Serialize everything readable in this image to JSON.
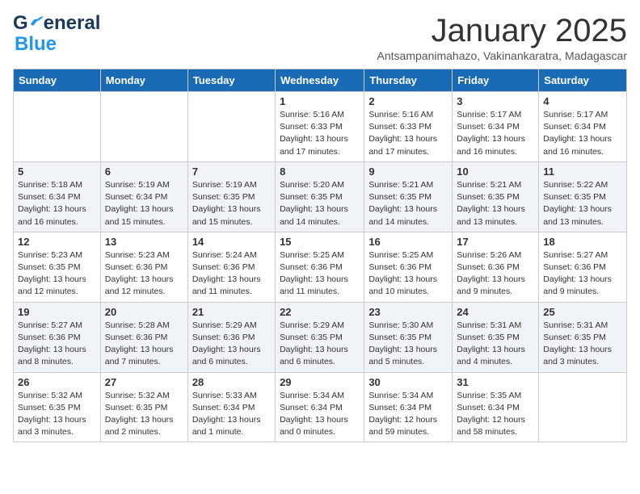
{
  "header": {
    "logo_line1": "General",
    "logo_line2": "Blue",
    "month_title": "January 2025",
    "subtitle": "Antsampanimahazo, Vakinankaratra, Madagascar"
  },
  "weekdays": [
    "Sunday",
    "Monday",
    "Tuesday",
    "Wednesday",
    "Thursday",
    "Friday",
    "Saturday"
  ],
  "weeks": [
    [
      {
        "num": "",
        "info": ""
      },
      {
        "num": "",
        "info": ""
      },
      {
        "num": "",
        "info": ""
      },
      {
        "num": "1",
        "info": "Sunrise: 5:16 AM\nSunset: 6:33 PM\nDaylight: 13 hours\nand 17 minutes."
      },
      {
        "num": "2",
        "info": "Sunrise: 5:16 AM\nSunset: 6:33 PM\nDaylight: 13 hours\nand 17 minutes."
      },
      {
        "num": "3",
        "info": "Sunrise: 5:17 AM\nSunset: 6:34 PM\nDaylight: 13 hours\nand 16 minutes."
      },
      {
        "num": "4",
        "info": "Sunrise: 5:17 AM\nSunset: 6:34 PM\nDaylight: 13 hours\nand 16 minutes."
      }
    ],
    [
      {
        "num": "5",
        "info": "Sunrise: 5:18 AM\nSunset: 6:34 PM\nDaylight: 13 hours\nand 16 minutes."
      },
      {
        "num": "6",
        "info": "Sunrise: 5:19 AM\nSunset: 6:34 PM\nDaylight: 13 hours\nand 15 minutes."
      },
      {
        "num": "7",
        "info": "Sunrise: 5:19 AM\nSunset: 6:35 PM\nDaylight: 13 hours\nand 15 minutes."
      },
      {
        "num": "8",
        "info": "Sunrise: 5:20 AM\nSunset: 6:35 PM\nDaylight: 13 hours\nand 14 minutes."
      },
      {
        "num": "9",
        "info": "Sunrise: 5:21 AM\nSunset: 6:35 PM\nDaylight: 13 hours\nand 14 minutes."
      },
      {
        "num": "10",
        "info": "Sunrise: 5:21 AM\nSunset: 6:35 PM\nDaylight: 13 hours\nand 13 minutes."
      },
      {
        "num": "11",
        "info": "Sunrise: 5:22 AM\nSunset: 6:35 PM\nDaylight: 13 hours\nand 13 minutes."
      }
    ],
    [
      {
        "num": "12",
        "info": "Sunrise: 5:23 AM\nSunset: 6:35 PM\nDaylight: 13 hours\nand 12 minutes."
      },
      {
        "num": "13",
        "info": "Sunrise: 5:23 AM\nSunset: 6:36 PM\nDaylight: 13 hours\nand 12 minutes."
      },
      {
        "num": "14",
        "info": "Sunrise: 5:24 AM\nSunset: 6:36 PM\nDaylight: 13 hours\nand 11 minutes."
      },
      {
        "num": "15",
        "info": "Sunrise: 5:25 AM\nSunset: 6:36 PM\nDaylight: 13 hours\nand 11 minutes."
      },
      {
        "num": "16",
        "info": "Sunrise: 5:25 AM\nSunset: 6:36 PM\nDaylight: 13 hours\nand 10 minutes."
      },
      {
        "num": "17",
        "info": "Sunrise: 5:26 AM\nSunset: 6:36 PM\nDaylight: 13 hours\nand 9 minutes."
      },
      {
        "num": "18",
        "info": "Sunrise: 5:27 AM\nSunset: 6:36 PM\nDaylight: 13 hours\nand 9 minutes."
      }
    ],
    [
      {
        "num": "19",
        "info": "Sunrise: 5:27 AM\nSunset: 6:36 PM\nDaylight: 13 hours\nand 8 minutes."
      },
      {
        "num": "20",
        "info": "Sunrise: 5:28 AM\nSunset: 6:36 PM\nDaylight: 13 hours\nand 7 minutes."
      },
      {
        "num": "21",
        "info": "Sunrise: 5:29 AM\nSunset: 6:36 PM\nDaylight: 13 hours\nand 6 minutes."
      },
      {
        "num": "22",
        "info": "Sunrise: 5:29 AM\nSunset: 6:35 PM\nDaylight: 13 hours\nand 6 minutes."
      },
      {
        "num": "23",
        "info": "Sunrise: 5:30 AM\nSunset: 6:35 PM\nDaylight: 13 hours\nand 5 minutes."
      },
      {
        "num": "24",
        "info": "Sunrise: 5:31 AM\nSunset: 6:35 PM\nDaylight: 13 hours\nand 4 minutes."
      },
      {
        "num": "25",
        "info": "Sunrise: 5:31 AM\nSunset: 6:35 PM\nDaylight: 13 hours\nand 3 minutes."
      }
    ],
    [
      {
        "num": "26",
        "info": "Sunrise: 5:32 AM\nSunset: 6:35 PM\nDaylight: 13 hours\nand 3 minutes."
      },
      {
        "num": "27",
        "info": "Sunrise: 5:32 AM\nSunset: 6:35 PM\nDaylight: 13 hours\nand 2 minutes."
      },
      {
        "num": "28",
        "info": "Sunrise: 5:33 AM\nSunset: 6:34 PM\nDaylight: 13 hours\nand 1 minute."
      },
      {
        "num": "29",
        "info": "Sunrise: 5:34 AM\nSunset: 6:34 PM\nDaylight: 13 hours\nand 0 minutes."
      },
      {
        "num": "30",
        "info": "Sunrise: 5:34 AM\nSunset: 6:34 PM\nDaylight: 12 hours\nand 59 minutes."
      },
      {
        "num": "31",
        "info": "Sunrise: 5:35 AM\nSunset: 6:34 PM\nDaylight: 12 hours\nand 58 minutes."
      },
      {
        "num": "",
        "info": ""
      }
    ]
  ]
}
